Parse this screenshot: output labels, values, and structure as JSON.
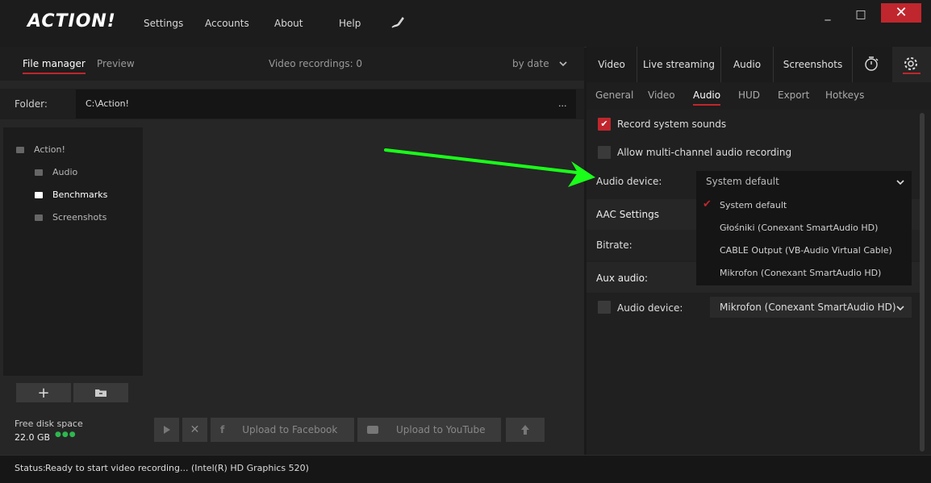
{
  "app": {
    "logo": "ACTION!",
    "nav": [
      "Settings",
      "Accounts",
      "About",
      "Help"
    ],
    "window": {
      "minimize": "_",
      "maximize": "□",
      "close": "✕"
    }
  },
  "left": {
    "tabs": [
      "File manager",
      "Preview"
    ],
    "recordings": "Video recordings: 0",
    "sort": "by date",
    "folder_label": "Folder:",
    "folder_path": "C:\\Action!",
    "folder_more": "...",
    "tree": [
      "Action!",
      "Audio",
      "Benchmarks",
      "Screenshots"
    ],
    "disk_label": "Free disk space",
    "disk_value": "22.0 GB",
    "disk_dots": "●●●",
    "actions": {
      "facebook": "Upload to Facebook",
      "youtube": "Upload to YouTube"
    }
  },
  "right": {
    "tabs": [
      "Video",
      "Live streaming",
      "Audio",
      "Screenshots"
    ],
    "subtabs": [
      "General",
      "Video",
      "Audio",
      "HUD",
      "Export",
      "Hotkeys"
    ],
    "record_system": "Record system sounds",
    "multichannel": "Allow multi-channel audio recording",
    "audio_device_label": "Audio device:",
    "audio_device_value": "System default",
    "options": [
      "System default",
      "Głośniki (Conexant SmartAudio HD)",
      "CABLE Output (VB-Audio Virtual Cable)",
      "Mikrofon (Conexant SmartAudio HD)"
    ],
    "aac": "AAC Settings",
    "bitrate": "Bitrate:",
    "aux": "Aux audio:",
    "aux_device_label": "Audio device:",
    "aux_device_value": "Mikrofon (Conexant SmartAudio HD)"
  },
  "status": {
    "label": "Status:",
    "text": "Ready to start video recording... (Intel(R) HD Graphics 520)"
  },
  "colors": {
    "accent": "#c0262d",
    "arrow": "#1aff1a"
  }
}
